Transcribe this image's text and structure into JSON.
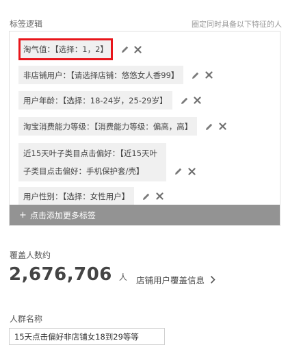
{
  "header": {
    "title": "标签逻辑",
    "note": "圈定同时具备以下特征的人"
  },
  "tags": [
    {
      "label": "淘气值：【选择：1，2】",
      "selected": true
    },
    {
      "label": "非店铺用户：【请选择店铺：悠悠女人香99】",
      "selected": false
    },
    {
      "label": "用户年龄：【选择：18-24岁，25-29岁】",
      "selected": false
    },
    {
      "label": "淘宝消费能力等级：【消费能力等级：偏高，高】",
      "selected": false
    },
    {
      "label": "近15天叶子类目点击偏好：【近15天叶子类目点击偏好：手机保护套/壳】",
      "selected": false
    },
    {
      "label": "用户性别：【选择：女性用户】",
      "selected": false
    }
  ],
  "add_bar": {
    "plus": "+",
    "label": "点击添加更多标签"
  },
  "coverage": {
    "label": "覆盖人数约",
    "count": "2,676,706",
    "unit": "人",
    "link_label": "店铺用户覆盖信息"
  },
  "audience_name": {
    "label": "人群名称",
    "value": "15天点击偏好非店铺女18到29等等"
  },
  "icons": {
    "edit": "pencil-icon",
    "delete": "close-icon",
    "link": "chevron-right-icon"
  },
  "colors": {
    "selected_border": "#e8151b",
    "add_bar_bg": "#939393",
    "tag_bg": "#f0f0f0"
  }
}
